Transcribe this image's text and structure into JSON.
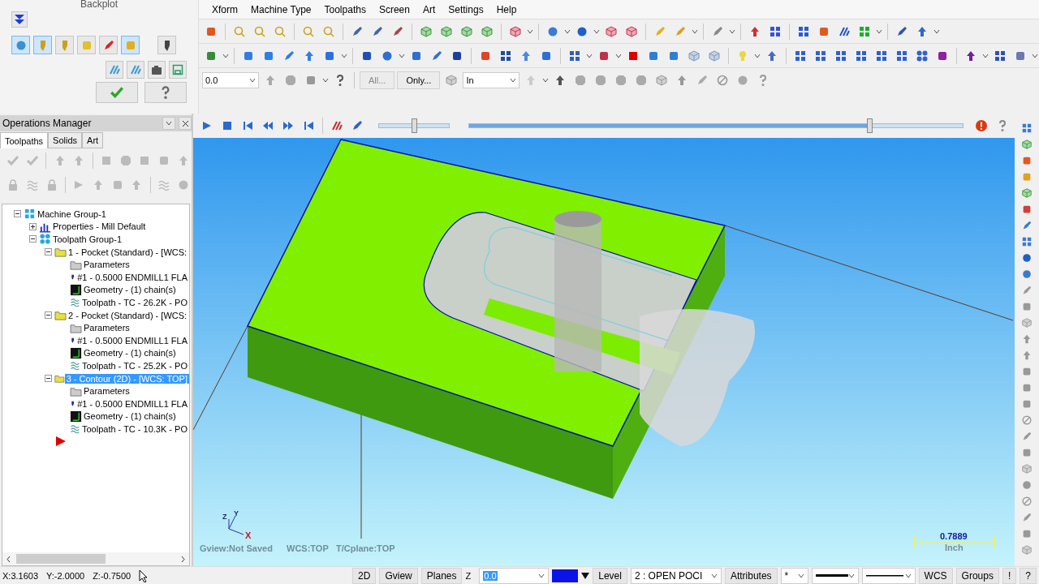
{
  "backplot": {
    "title": "Backplot",
    "toggles": [
      {
        "selected": true
      },
      {
        "selected": true
      },
      {
        "selected": false
      },
      {
        "selected": false
      },
      {
        "selected": false
      },
      {
        "selected": true
      }
    ]
  },
  "menu": [
    "Xform",
    "Machine Type",
    "Toolpaths",
    "Screen",
    "Art",
    "Settings",
    "Help"
  ],
  "toolbar": {
    "depth_value": "0.0",
    "all_button": "All...",
    "only_button": "Only...",
    "mode_value": "In"
  },
  "operations_manager": {
    "title": "Operations Manager",
    "tabs": [
      {
        "label": "Toolpaths",
        "selected": true
      },
      {
        "label": "Solids",
        "selected": false
      },
      {
        "label": "Art",
        "selected": false
      }
    ],
    "tree": [
      {
        "label": "Machine Group-1",
        "kind": "machine",
        "expanded": true,
        "selected": false,
        "children": [
          {
            "label": "Properties - Mill Default",
            "kind": "properties",
            "expanded": false,
            "selected": false
          },
          {
            "label": "Toolpath Group-1",
            "kind": "group",
            "expanded": true,
            "selected": false,
            "children": [
              {
                "label": "1 - Pocket (Standard) - [WCS:",
                "kind": "operation",
                "expanded": true,
                "selected": false,
                "children": [
                  {
                    "label": "Parameters",
                    "kind": "parameters",
                    "selected": false
                  },
                  {
                    "label": "#1 - 0.5000 ENDMILL1 FLA",
                    "kind": "tool",
                    "selected": false
                  },
                  {
                    "label": "Geometry - (1) chain(s)",
                    "kind": "geometry",
                    "selected": false
                  },
                  {
                    "label": "Toolpath - TC - 26.2K - PO",
                    "kind": "toolpath",
                    "selected": false
                  }
                ]
              },
              {
                "label": "2 - Pocket (Standard) - [WCS:",
                "kind": "operation",
                "expanded": true,
                "selected": false,
                "children": [
                  {
                    "label": "Parameters",
                    "kind": "parameters",
                    "selected": false
                  },
                  {
                    "label": "#1 - 0.5000 ENDMILL1 FLA",
                    "kind": "tool",
                    "selected": false
                  },
                  {
                    "label": "Geometry - (1) chain(s)",
                    "kind": "geometry",
                    "selected": false
                  },
                  {
                    "label": "Toolpath - TC - 25.2K - PO",
                    "kind": "toolpath",
                    "selected": false
                  }
                ]
              },
              {
                "label": "3 - Contour (2D) - [WCS: TOP]",
                "kind": "operation",
                "expanded": true,
                "selected": true,
                "children": [
                  {
                    "label": "Parameters",
                    "kind": "parameters",
                    "selected": false
                  },
                  {
                    "label": "#1 - 0.5000 ENDMILL1 FLA",
                    "kind": "tool",
                    "selected": false
                  },
                  {
                    "label": "Geometry - (1) chain(s)",
                    "kind": "geometry",
                    "selected": false
                  },
                  {
                    "label": "Toolpath - TC - 10.3K - PO",
                    "kind": "toolpath",
                    "selected": false
                  }
                ]
              }
            ]
          }
        ]
      }
    ]
  },
  "playback": {
    "speed": {
      "level": 0.5
    },
    "progress": {
      "level": 0.81
    }
  },
  "viewport": {
    "axis_labels": [
      "Z",
      "Y",
      "X"
    ],
    "view_info": [
      "Gview:Not Saved",
      "WCS:TOP",
      "T/Cplane:TOP"
    ],
    "scale_value": "0.7889",
    "scale_unit": "Inch"
  },
  "status_bar": {
    "coordinates": [
      "X:3.1603",
      "Y:-2.0000",
      "Z:-0.7500"
    ],
    "buttons": [
      "2D",
      "Gview",
      "Planes"
    ],
    "z_label": "Z",
    "z_value": "0.0",
    "level_button": "Level",
    "level_value": "2 : OPEN POCI",
    "attributes_button": "Attributes",
    "point_style": "*",
    "right_buttons": [
      "WCS",
      "Groups",
      "!",
      "?"
    ]
  }
}
